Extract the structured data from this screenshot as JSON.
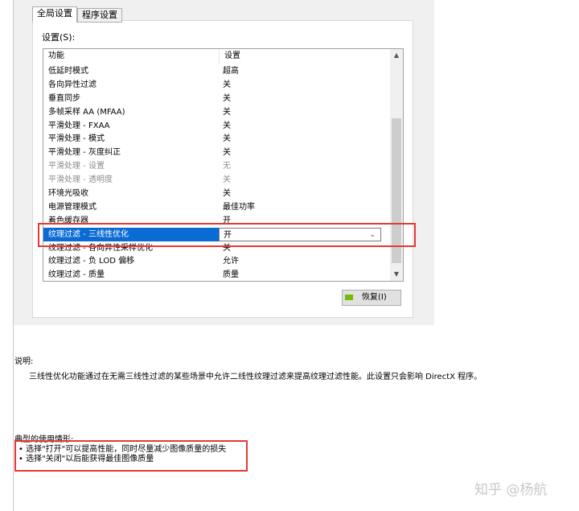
{
  "tabs": [
    "全局设置",
    "程序设置"
  ],
  "settings_label": "设置(S):",
  "columns": [
    "功能",
    "设置"
  ],
  "rows": [
    {
      "feature": "低延时模式",
      "setting": "超高",
      "disabled": false,
      "selected": false
    },
    {
      "feature": "各向异性过滤",
      "setting": "关",
      "disabled": false,
      "selected": false
    },
    {
      "feature": "垂直同步",
      "setting": "关",
      "disabled": false,
      "selected": false
    },
    {
      "feature": "多帧采样 AA (MFAA)",
      "setting": "关",
      "disabled": false,
      "selected": false
    },
    {
      "feature": "平滑处理 - FXAA",
      "setting": "关",
      "disabled": false,
      "selected": false
    },
    {
      "feature": "平滑处理 - 模式",
      "setting": "关",
      "disabled": false,
      "selected": false
    },
    {
      "feature": "平滑处理 - 灰度纠正",
      "setting": "关",
      "disabled": false,
      "selected": false
    },
    {
      "feature": "平滑处理 - 设置",
      "setting": "无",
      "disabled": true,
      "selected": false
    },
    {
      "feature": "平滑处理 - 透明度",
      "setting": "关",
      "disabled": true,
      "selected": false
    },
    {
      "feature": "环境光吸收",
      "setting": "关",
      "disabled": false,
      "selected": false
    },
    {
      "feature": "电源管理模式",
      "setting": "最佳功率",
      "disabled": false,
      "selected": false
    },
    {
      "feature": "着色缓存器",
      "setting": "开",
      "disabled": false,
      "selected": false
    },
    {
      "feature": "纹理过滤 - 三线性优化",
      "setting": "开",
      "disabled": false,
      "selected": true
    },
    {
      "feature": "纹理过滤 - 各向异性采样优化",
      "setting": "关",
      "disabled": false,
      "selected": false
    },
    {
      "feature": "纹理过滤 - 负 LOD 偏移",
      "setting": "允许",
      "disabled": false,
      "selected": false
    },
    {
      "feature": "纹理过滤 - 质量",
      "setting": "质量",
      "disabled": false,
      "selected": false
    }
  ],
  "restore_button": "恢复(I)",
  "description_title": "说明:",
  "description_text": "三线性优化功能通过在无需三线性过滤的某些场景中允许二线性纹理过滤来提高纹理过滤性能。此设置只会影响 DirectX 程序。",
  "usage_title": "典型的使用情形:",
  "usage_items": [
    "• 选择\"打开\"可以提高性能，同时尽量减少图像质量的损失",
    "• 选择\"关闭\"以后能获得最佳图像质量"
  ],
  "watermark": "知乎 @杨航",
  "icons": {
    "scroll_up": "chevron-up-icon",
    "scroll_down": "chevron-down-icon",
    "dropdown": "chevron-down-icon",
    "restore": "nvidia-icon"
  },
  "colors": {
    "selection": "#0a6bd4",
    "highlight_box": "#e53935",
    "nvidia": "#76b900"
  }
}
